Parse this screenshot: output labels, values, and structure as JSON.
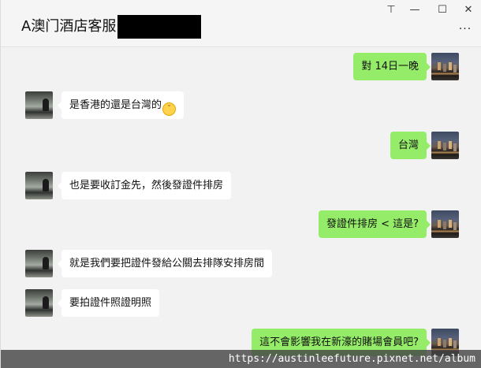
{
  "window": {
    "title": "A澳门酒店客服",
    "controls": {
      "pin_icon": "⊤",
      "minimize_icon": "—",
      "maximize_icon": "☐",
      "close_icon": "✕"
    },
    "more_icon": "···"
  },
  "messages": [
    {
      "side": "right",
      "text": "對 14日一晚"
    },
    {
      "side": "left",
      "text": "是香港的還是台灣的"
    },
    {
      "side": "right",
      "text": "台灣"
    },
    {
      "side": "left",
      "text": "也是要收訂金先，然後發證件排房"
    },
    {
      "side": "right",
      "text": "發證件排房 < 這是?"
    },
    {
      "side": "left",
      "text": "就是我們要把證件發給公關去排隊安排房間"
    },
    {
      "side": "left",
      "text": "要拍證件照證明照"
    },
    {
      "side": "right",
      "text": "這不會影響我在新濠的賭場會員吧?"
    }
  ],
  "footer": {
    "watermark": "https://austinleefuture.pixnet.net/album"
  },
  "colors": {
    "self_bubble": "#95ec69",
    "other_bubble": "#ffffff",
    "chat_background": "#f2f2f2"
  }
}
